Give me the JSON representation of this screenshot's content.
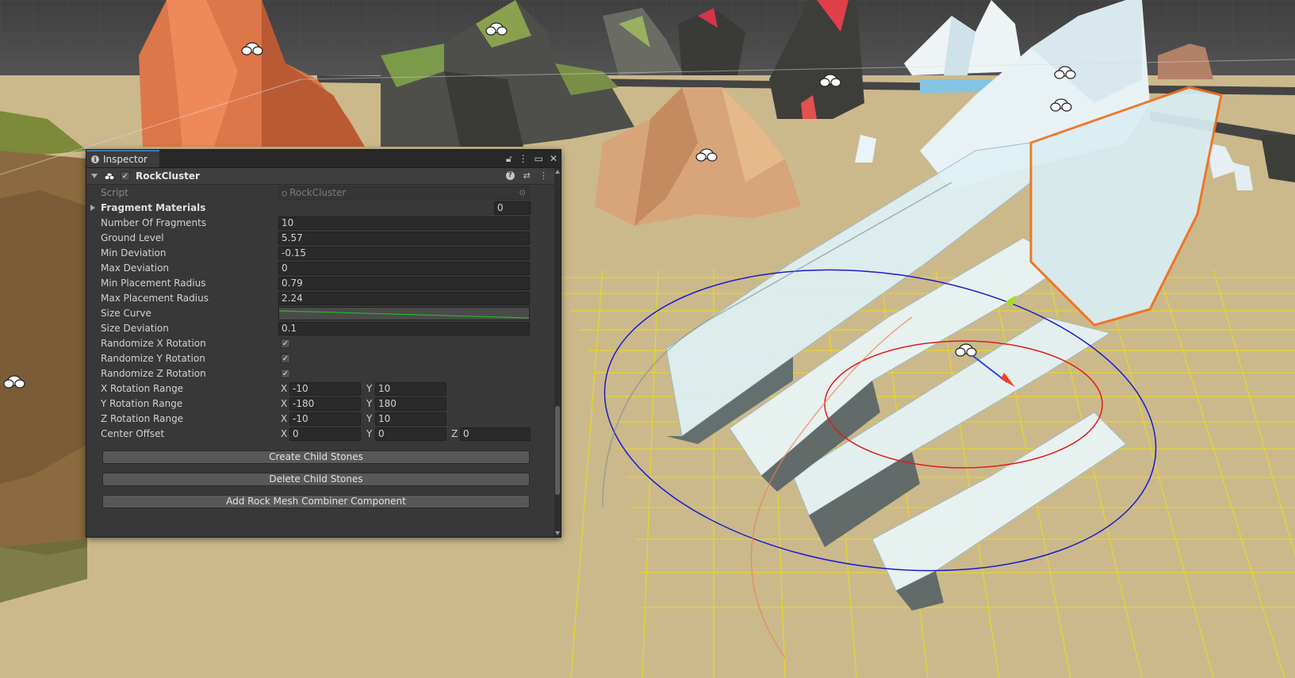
{
  "inspector": {
    "tab_title": "Inspector",
    "component_name": "RockCluster",
    "component_enabled": true,
    "script": {
      "label": "Script",
      "value": "RockCluster"
    },
    "fragment_materials": {
      "label": "Fragment Materials",
      "size": "0"
    },
    "number_of_fragments": {
      "label": "Number Of Fragments",
      "value": "10"
    },
    "ground_level": {
      "label": "Ground Level",
      "value": "5.57"
    },
    "min_deviation": {
      "label": "Min Deviation",
      "value": "-0.15"
    },
    "max_deviation": {
      "label": "Max Deviation",
      "value": "0"
    },
    "min_placement_radius": {
      "label": "Min Placement Radius",
      "value": "0.79"
    },
    "max_placement_radius": {
      "label": "Max Placement Radius",
      "value": "2.24"
    },
    "size_curve": {
      "label": "Size Curve",
      "curve_color": "#20c020"
    },
    "size_deviation": {
      "label": "Size Deviation",
      "value": "0.1"
    },
    "randomize_x": {
      "label": "Randomize X Rotation",
      "checked": true
    },
    "randomize_y": {
      "label": "Randomize Y Rotation",
      "checked": true
    },
    "randomize_z": {
      "label": "Randomize Z Rotation",
      "checked": true
    },
    "x_rotation_range": {
      "label": "X Rotation Range",
      "x_label": "X",
      "x": "-10",
      "y_label": "Y",
      "y": "10"
    },
    "y_rotation_range": {
      "label": "Y Rotation Range",
      "x_label": "X",
      "x": "-180",
      "y_label": "Y",
      "y": "180"
    },
    "z_rotation_range": {
      "label": "Z Rotation Range",
      "x_label": "X",
      "x": "-10",
      "y_label": "Y",
      "y": "10"
    },
    "center_offset": {
      "label": "Center Offset",
      "x_label": "X",
      "x": "0",
      "y_label": "Y",
      "y": "0",
      "z_label": "Z",
      "z": "0"
    },
    "buttons": {
      "create": "Create Child Stones",
      "delete": "Delete Child Stones",
      "add_combiner": "Add Rock Mesh Combiner Component"
    },
    "check_glyph": "✓"
  },
  "scene": {
    "ground_color": "#cbb98c",
    "sky_color": "#4a4a4a",
    "grid_color": "#f2e200",
    "gizmo_icon": "rock-cluster-icon"
  }
}
